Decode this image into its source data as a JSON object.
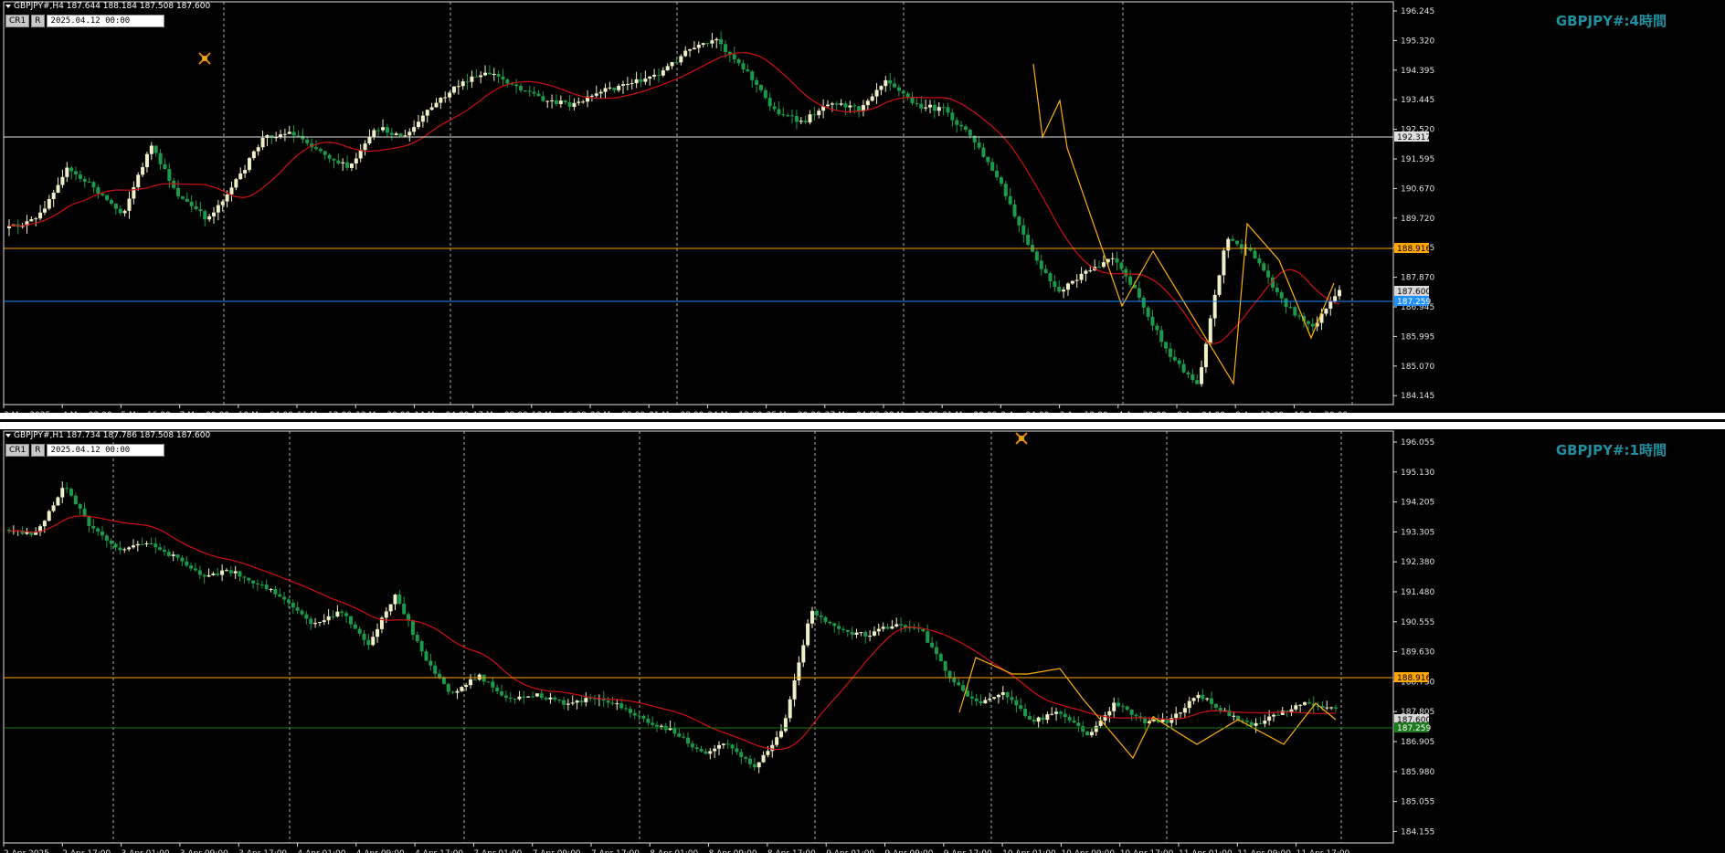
{
  "top": {
    "header": "GBPJPY#,H4  187.644 188.184 187.508 187.600",
    "btn_cr1": "CR1",
    "btn_r": "R",
    "datetime": "2025.04.12 00:00",
    "title": "GBPJPY#:4時間",
    "price_ticks": [
      "196.245",
      "195.320",
      "194.395",
      "193.445",
      "192.520",
      "191.595",
      "190.670",
      "189.720",
      "188.795",
      "187.870",
      "186.945",
      "185.995",
      "185.070",
      "184.145"
    ],
    "time_ticks": [
      "3 Mar 2025",
      "4 Mar 08:00",
      "5 Mar 16:00",
      "7 Mar 00:00",
      "10 Mar 04:00",
      "11 Mar 12:00",
      "12 Mar 20:00",
      "14 Mar 04:00",
      "17 Mar 08:00",
      "18 Mar 16:00",
      "20 Mar 00:00",
      "21 Mar 08:00",
      "24 Mar 12:00",
      "25 Mar 20:00",
      "27 Mar 04:00",
      "28 Mar 12:00",
      "31 Mar 20:00",
      "2 Apr 04:00",
      "3 Apr 12:00",
      "4 Apr 20:00",
      "8 Apr 04:00",
      "9 Apr 12:00",
      "10 Apr 20:00"
    ],
    "hlines": [
      {
        "label": "192.317",
        "color": "#e0e0e0"
      },
      {
        "label": "188.916",
        "color": "#ffa500"
      },
      {
        "label": "187.600",
        "color": "#404040"
      },
      {
        "label": "187.259",
        "color": "#1e90ff"
      }
    ]
  },
  "bottom": {
    "header": "GBPJPY#,H1  187.734 187.786 187.508 187.600",
    "btn_cr1": "CR1",
    "btn_r": "R",
    "datetime": "2025.04.12 00:00",
    "title": "GBPJPY#:1時間",
    "price_ticks": [
      "196.055",
      "195.130",
      "194.205",
      "193.305",
      "192.380",
      "191.480",
      "190.555",
      "189.630",
      "188.730",
      "187.805",
      "186.905",
      "185.980",
      "185.055",
      "184.155"
    ],
    "time_ticks": [
      "2 Apr 2025",
      "2 Apr 17:00",
      "3 Apr 01:00",
      "3 Apr 09:00",
      "3 Apr 17:00",
      "4 Apr 01:00",
      "4 Apr 09:00",
      "4 Apr 17:00",
      "7 Apr 01:00",
      "7 Apr 09:00",
      "7 Apr 17:00",
      "8 Apr 01:00",
      "8 Apr 09:00",
      "8 Apr 17:00",
      "9 Apr 01:00",
      "9 Apr 09:00",
      "9 Apr 17:00",
      "10 Apr 01:00",
      "10 Apr 09:00",
      "10 Apr 17:00",
      "11 Apr 01:00",
      "11 Apr 09:00",
      "11 Apr 17:00"
    ],
    "hlines": [
      {
        "label": "188.916",
        "color": "#ffa500"
      },
      {
        "label": "187.600",
        "color": "#404040"
      },
      {
        "label": "187.259",
        "color": "#1a7a1a"
      }
    ]
  },
  "colors": {
    "bull": "#f0f0c8",
    "bear": "#1a9a4a",
    "ma": "#d01010",
    "zigzag": "#ffb000",
    "grid": "#b0b0b0"
  }
}
